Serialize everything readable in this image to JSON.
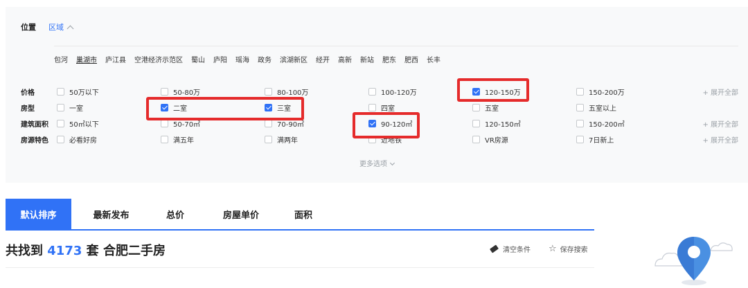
{
  "location": {
    "label": "位置",
    "tab": "区域"
  },
  "districts": [
    "包河",
    "巢湖市",
    "庐江县",
    "空港经济示范区",
    "蜀山",
    "庐阳",
    "瑶海",
    "政务",
    "滨湖新区",
    "经开",
    "高新",
    "新站",
    "肥东",
    "肥西",
    "长丰"
  ],
  "active_district": "巢湖市",
  "filters": {
    "price": {
      "label": "价格",
      "options": [
        {
          "label": "50万以下",
          "checked": false
        },
        {
          "label": "50-80万",
          "checked": false
        },
        {
          "label": "80-100万",
          "checked": false
        },
        {
          "label": "100-120万",
          "checked": false
        },
        {
          "label": "120-150万",
          "checked": true
        },
        {
          "label": "150-200万",
          "checked": false
        }
      ],
      "expand": "+ 展开全部"
    },
    "room": {
      "label": "房型",
      "options": [
        {
          "label": "一室",
          "checked": false
        },
        {
          "label": "二室",
          "checked": true
        },
        {
          "label": "三室",
          "checked": true
        },
        {
          "label": "四室",
          "checked": false
        },
        {
          "label": "五室",
          "checked": false
        },
        {
          "label": "五室以上",
          "checked": false
        }
      ]
    },
    "area": {
      "label": "建筑面积",
      "options": [
        {
          "label": "50㎡以下",
          "checked": false
        },
        {
          "label": "50-70㎡",
          "checked": false
        },
        {
          "label": "70-90㎡",
          "checked": false
        },
        {
          "label": "90-120㎡",
          "checked": true
        },
        {
          "label": "120-150㎡",
          "checked": false
        },
        {
          "label": "150-200㎡",
          "checked": false
        }
      ],
      "expand": "+ 展开全部"
    },
    "feature": {
      "label": "房源特色",
      "options": [
        {
          "label": "必看好房",
          "checked": false
        },
        {
          "label": "满五年",
          "checked": false
        },
        {
          "label": "满两年",
          "checked": false
        },
        {
          "label": "近地铁",
          "checked": false
        },
        {
          "label": "VR房源",
          "checked": false
        },
        {
          "label": "7日新上",
          "checked": false
        }
      ],
      "expand": "+ 展开全部"
    }
  },
  "more_options": "更多选项",
  "sort_tabs": [
    "默认排序",
    "最新发布",
    "总价",
    "房屋单价",
    "面积"
  ],
  "result": {
    "prefix": "共找到",
    "count": "4173",
    "suffix": "套 合肥二手房"
  },
  "actions": {
    "clear": "清空条件",
    "save": "保存搜索"
  },
  "colors": {
    "accent": "#3072f6",
    "highlight": "#e52b2b",
    "panel_bg": "#f8f9fa"
  },
  "icons": {
    "clear": "eraser-icon",
    "save": "star-outline-icon",
    "map": "map-pin-icon"
  }
}
